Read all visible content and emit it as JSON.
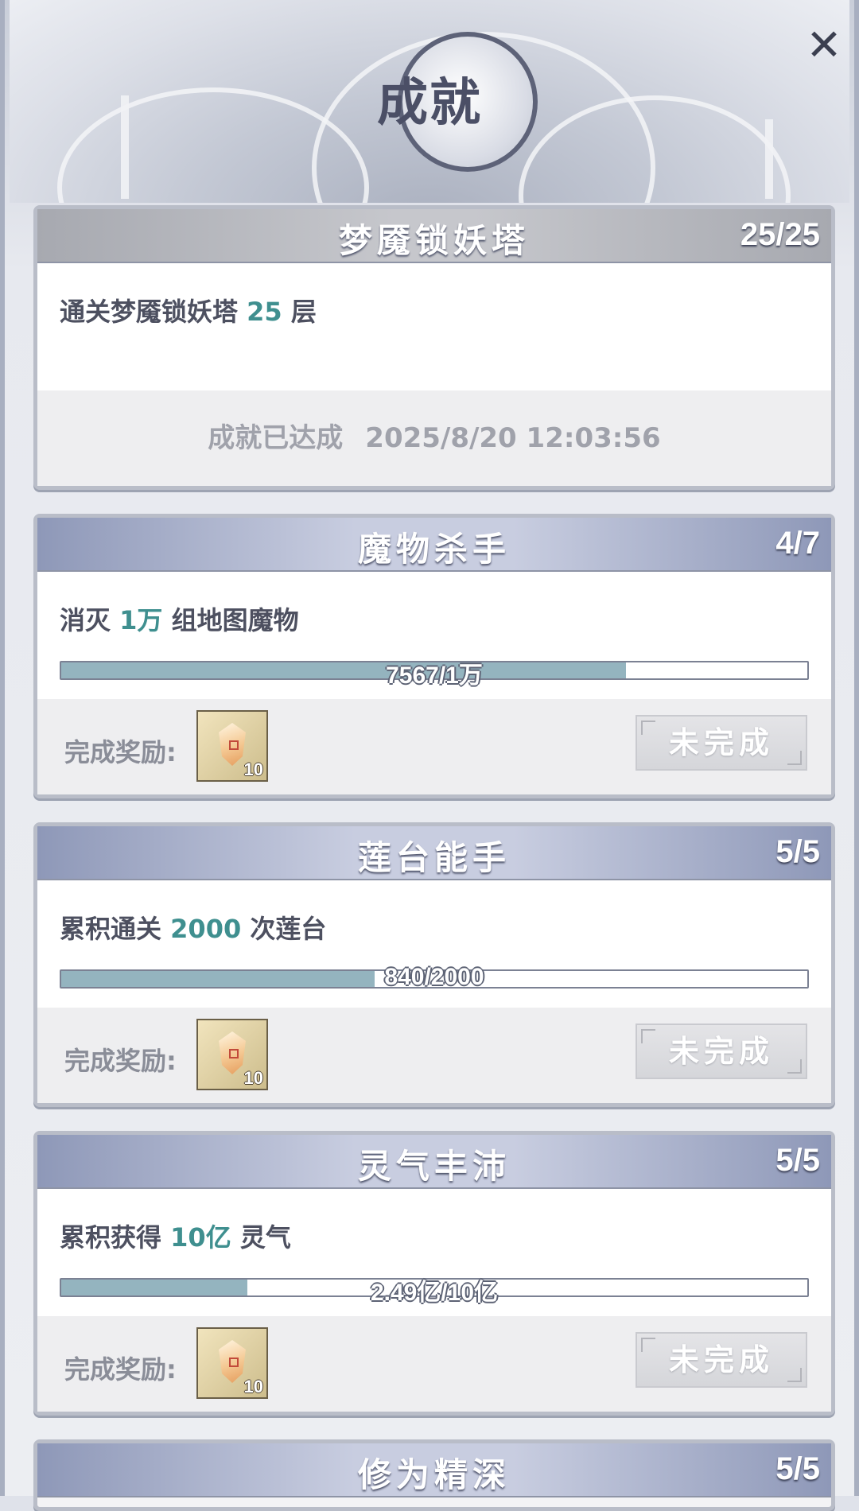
{
  "header": {
    "title": "成就",
    "close_icon": "close-icon"
  },
  "achievements": [
    {
      "title": "梦魇锁妖塔",
      "count": "25/25",
      "desc_prefix": "通关梦魇锁妖塔",
      "desc_highlight": "25",
      "desc_suffix": "层",
      "status_label": "成就已达成",
      "completed_time": "2025/8/20 12:03:56"
    },
    {
      "title": "魔物杀手",
      "count": "4/7",
      "desc_prefix": "消灭",
      "desc_highlight": "1万",
      "desc_suffix": "组地图魔物",
      "progress_text": "7567/1万",
      "progress_fraction": 0.7567,
      "reward_label": "完成奖励:",
      "reward_icon": "gem-icon",
      "reward_qty": "10",
      "button_label": "未完成"
    },
    {
      "title": "莲台能手",
      "count": "5/5",
      "desc_prefix": "累积通关",
      "desc_highlight": "2000",
      "desc_suffix": "次莲台",
      "progress_text": "840/2000",
      "progress_fraction": 0.42,
      "reward_label": "完成奖励:",
      "reward_icon": "gem-icon",
      "reward_qty": "10",
      "button_label": "未完成"
    },
    {
      "title": "灵气丰沛",
      "count": "5/5",
      "desc_prefix": "累积获得",
      "desc_highlight": "10亿",
      "desc_suffix": "灵气",
      "progress_text": "2.49亿/10亿",
      "progress_fraction": 0.249,
      "reward_label": "完成奖励:",
      "reward_icon": "gem-icon",
      "reward_qty": "10",
      "button_label": "未完成"
    },
    {
      "title": "修为精深",
      "count": "5/5"
    }
  ],
  "colors": {
    "highlight": "#3f8f8f",
    "progress_fill": "#94b4bf"
  }
}
